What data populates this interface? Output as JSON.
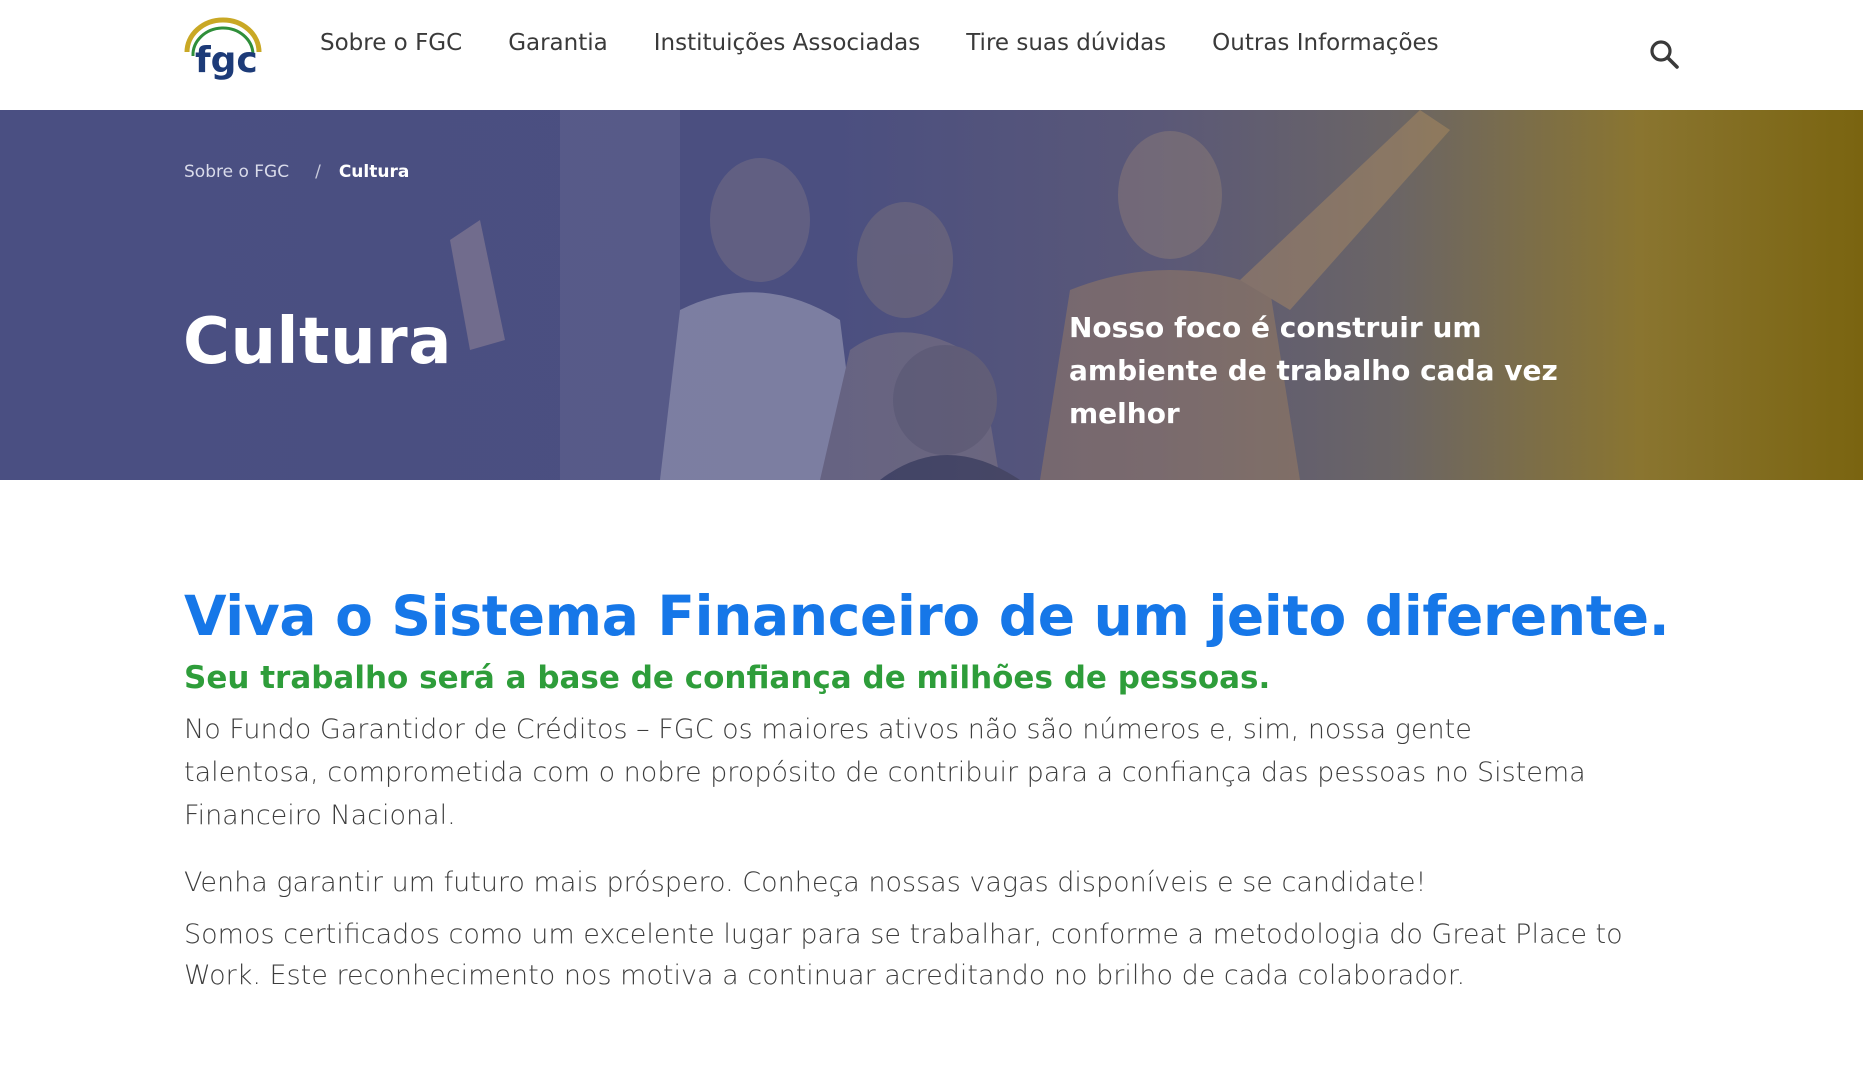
{
  "header": {
    "logo_text": "fgc",
    "nav": [
      {
        "label": "Sobre o FGC"
      },
      {
        "label": "Garantia"
      },
      {
        "label": "Instituições Associadas"
      },
      {
        "label": "Tire suas dúvidas"
      },
      {
        "label": "Outras Informações"
      }
    ],
    "search_icon": "search-icon"
  },
  "hero": {
    "breadcrumb": {
      "parent": "Sobre o FGC",
      "separator": "/",
      "current": "Cultura"
    },
    "title": "Cultura",
    "tagline": "Nosso foco é construir um ambiente de trabalho cada vez melhor"
  },
  "content": {
    "headline": "Viva o Sistema Financeiro de um jeito diferente.",
    "subheadline": "Seu trabalho será a base de confiança de milhões de pessoas.",
    "paragraph1": "No Fundo Garantidor de Créditos – FGC os maiores ativos não são números e, sim, nossa gente talentosa, comprometida com o nobre propósito de contribuir para a confiança das pessoas no Sistema Financeiro Nacional.",
    "paragraph2": "Venha garantir um futuro mais próspero. Conheça nossas vagas disponíveis e se candidate!",
    "paragraph3": "Somos certificados como um excelente lugar para se trabalhar, conforme a metodologia do Great Place to Work. Este reconhecimento nos motiva a continuar acreditando no brilho de cada colaborador."
  },
  "colors": {
    "headline": "#1677e8",
    "subheadline": "#2e9d3a",
    "hero_overlay_left": "#4a4f82",
    "hero_overlay_right": "#7a6410"
  }
}
